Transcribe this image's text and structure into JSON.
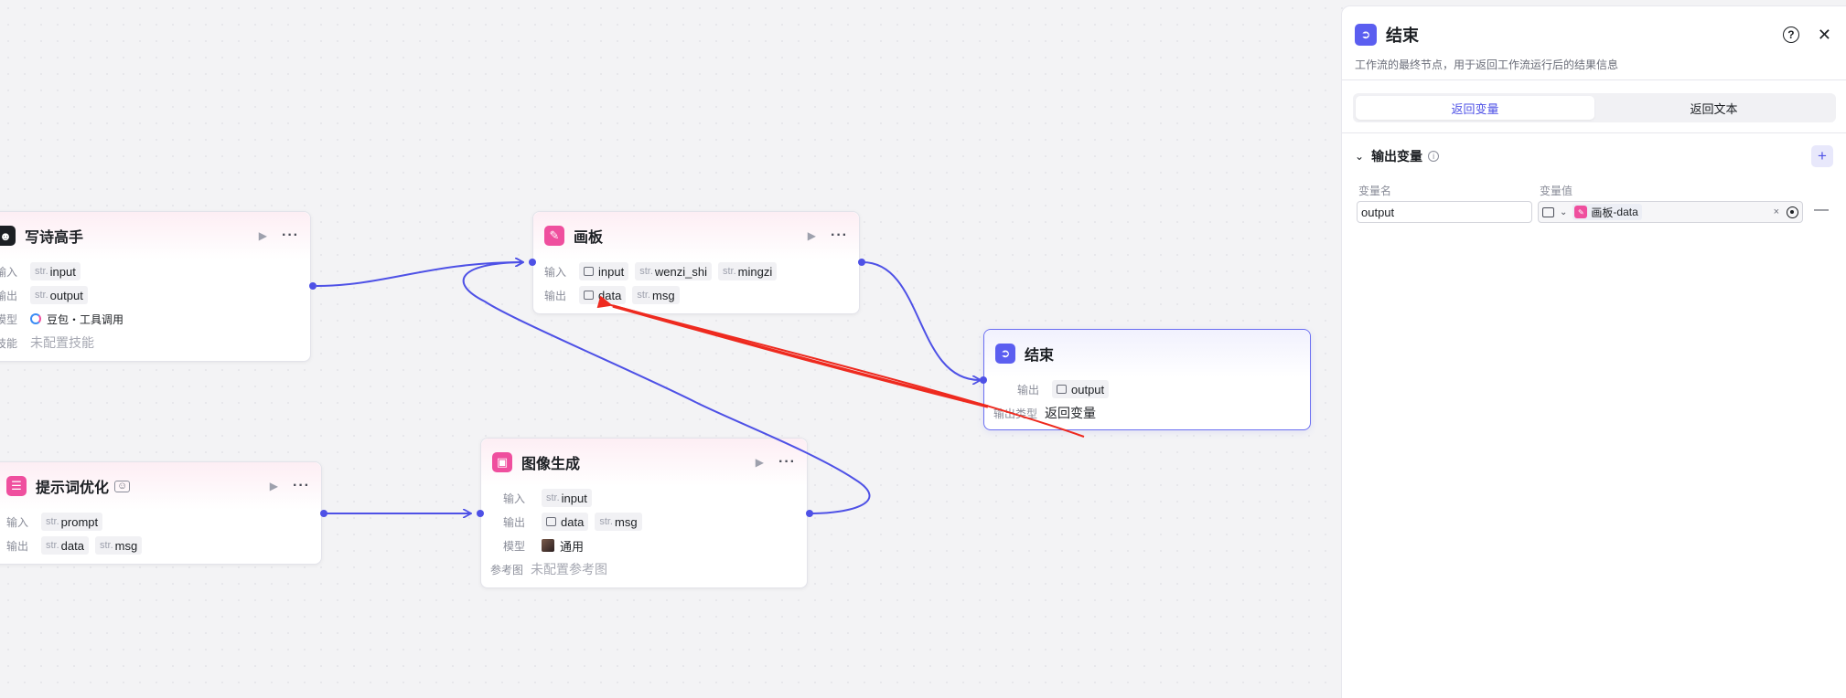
{
  "nodes": {
    "poet": {
      "title": "写诗高手",
      "input_label": "输入",
      "output_label": "输出",
      "model_label": "模型",
      "skill_label": "技能",
      "input_type": "str.",
      "input_var": "input",
      "output_type": "str.",
      "output_var": "output",
      "model_value": "豆包・工具调用",
      "skill_value": "未配置技能"
    },
    "canvas": {
      "title": "画板",
      "input_label": "输入",
      "output_label": "输出",
      "inputs": [
        {
          "type": "",
          "name": "input"
        },
        {
          "type": "str.",
          "name": "wenzi_shi"
        },
        {
          "type": "str.",
          "name": "mingzi"
        }
      ],
      "outputs": [
        {
          "type": "",
          "name": "data"
        },
        {
          "type": "str.",
          "name": "msg"
        }
      ]
    },
    "end_node": {
      "title": "结束",
      "output_label": "输出",
      "output_var": "output",
      "output_type_label": "输出类型",
      "output_type_value": "返回变量"
    },
    "prompt_opt": {
      "title": "提示词优化",
      "input_label": "输入",
      "output_label": "输出",
      "input_type": "str.",
      "input_var": "prompt",
      "outputs": [
        {
          "type": "str.",
          "name": "data"
        },
        {
          "type": "str.",
          "name": "msg"
        }
      ]
    },
    "image_gen": {
      "title": "图像生成",
      "input_label": "输入",
      "output_label": "输出",
      "model_label": "模型",
      "ref_label": "参考图",
      "input_type": "str.",
      "input_var": "input",
      "outputs": [
        {
          "type": "",
          "name": "data"
        },
        {
          "type": "str.",
          "name": "msg"
        }
      ],
      "model_value": "通用",
      "ref_value": "未配置参考图"
    }
  },
  "panel": {
    "title": "结束",
    "help_glyph": "?",
    "close_glyph": "✕",
    "description": "工作流的最终节点，用于返回工作流运行后的结果信息",
    "tabs": [
      "返回变量",
      "返回文本"
    ],
    "section_title": "输出变量",
    "col_name": "变量名",
    "col_value": "变量值",
    "var_name_value": "output",
    "ref_node": "画板",
    "ref_separator": " - ",
    "ref_var": "data",
    "add_glyph": "+",
    "remove_glyph": "—",
    "clear_glyph": "×"
  },
  "colors": {
    "accent": "#4e51e6",
    "edge": "#4e51e6",
    "annotation_arrow": "#ee2a1f",
    "node_icon_pink": "#ef4f9e",
    "node_icon_blue": "#5b5ef0"
  },
  "icons": {
    "poet": "robot-icon",
    "canvas": "canvas-board-icon",
    "end": "exit-icon",
    "prompt_opt": "list-icon",
    "image_gen": "image-icon"
  }
}
